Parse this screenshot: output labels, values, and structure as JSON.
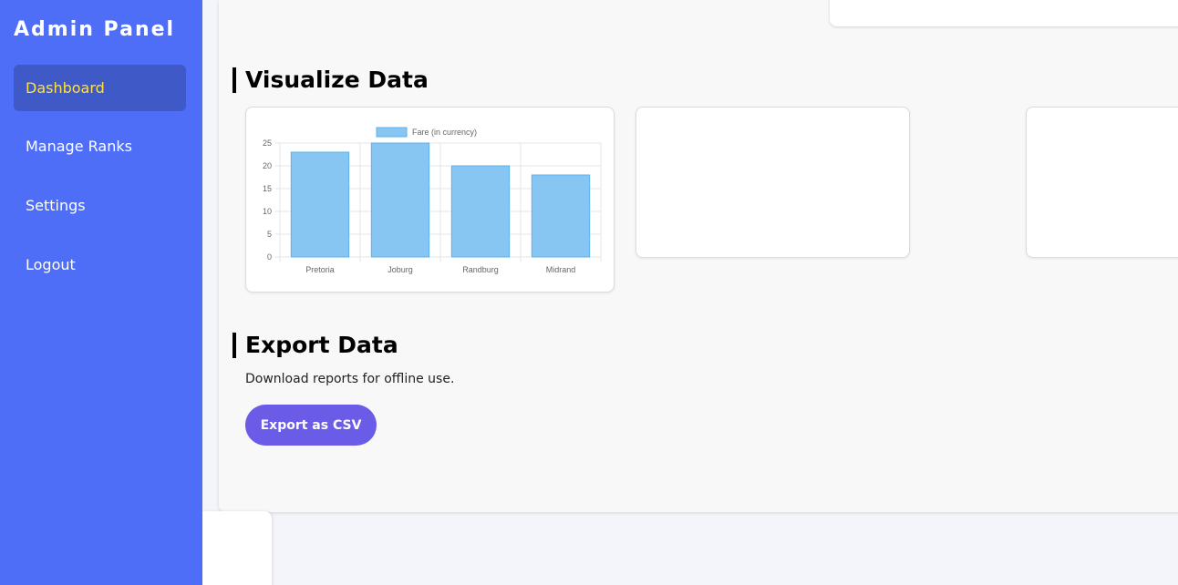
{
  "sidebar": {
    "brand": "Admin Panel",
    "items": [
      {
        "label": "Dashboard",
        "active": true
      },
      {
        "label": "Manage Ranks",
        "active": false
      },
      {
        "label": "Settings",
        "active": false
      },
      {
        "label": "Logout",
        "active": false
      }
    ]
  },
  "visualize": {
    "title": "Visualize Data"
  },
  "export": {
    "title": "Export Data",
    "description": "Download reports for offline use.",
    "button_label": "Export as CSV"
  },
  "colors": {
    "sidebar_bg": "#4f6ef7",
    "active_item_bg": "#3f59c6",
    "active_item_text": "#fde047",
    "bar_fill": "#87c6f3",
    "bar_border": "#5eb0ea",
    "button_bg": "#6b5ce7"
  },
  "chart_data": {
    "type": "bar",
    "categories": [
      "Pretoria",
      "Joburg",
      "Randburg",
      "Midrand"
    ],
    "series": [
      {
        "name": "Fare (in currency)",
        "values": [
          23,
          25,
          20,
          18
        ]
      }
    ],
    "yticks": [
      "0",
      "5",
      "10",
      "15",
      "20",
      "25"
    ],
    "ylim": [
      0,
      25
    ],
    "grid": true,
    "legend": "top"
  }
}
